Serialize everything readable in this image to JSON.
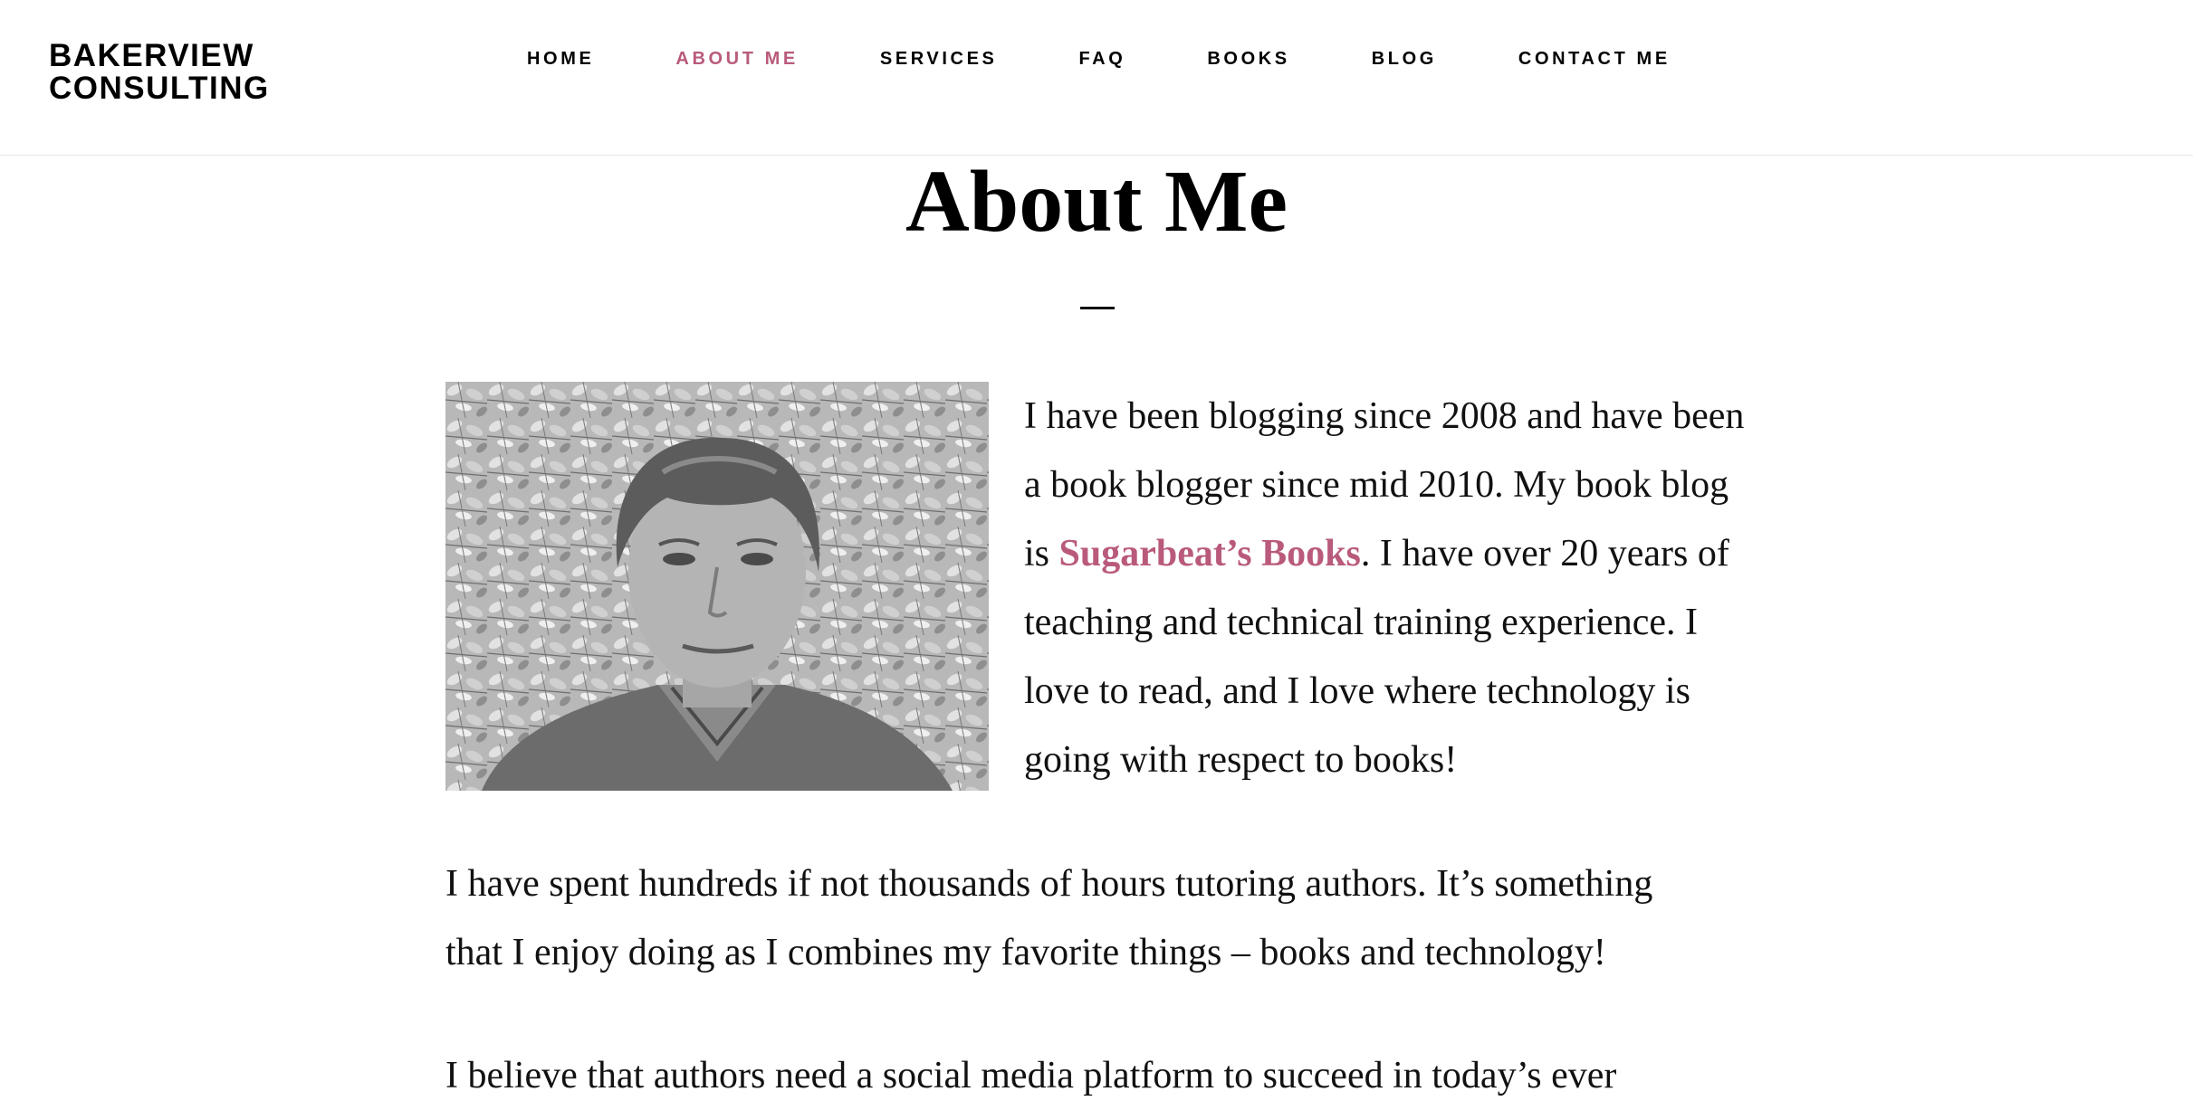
{
  "header": {
    "brand": {
      "line1": "BAKERVIEW",
      "line2": "CONSULTING"
    },
    "nav": [
      {
        "label": "HOME",
        "active": false
      },
      {
        "label": "ABOUT ME",
        "active": true
      },
      {
        "label": "SERVICES",
        "active": false
      },
      {
        "label": "FAQ",
        "active": false
      },
      {
        "label": "BOOKS",
        "active": false
      },
      {
        "label": "BLOG",
        "active": false
      },
      {
        "label": "CONTACT ME",
        "active": false
      }
    ]
  },
  "main": {
    "title": "About Me",
    "intro": {
      "line1": "I have been blogging since 2008 and have been",
      "line2": "a book blogger since mid 2010.  My book blog",
      "line3_before": "is ",
      "line3_link": "Sugarbeat’s Books",
      "line3_after": ".  I have over 20 years of",
      "line4": "teaching and technical training experience.  I",
      "line5": "love to read, and I love where technology is",
      "line6": "going with respect to books!"
    },
    "paragraph2": {
      "line1": "I  have spent hundreds if not thousands of hours tutoring authors.  It’s something",
      "line2": "that I enjoy doing as I combines my favorite things – books and technology!"
    },
    "paragraph3": {
      "line1": "I believe that authors need a social media platform to succeed in today’s ever"
    }
  },
  "colors": {
    "accent": "#b95a7c",
    "text": "#111111",
    "background": "#ffffff"
  }
}
